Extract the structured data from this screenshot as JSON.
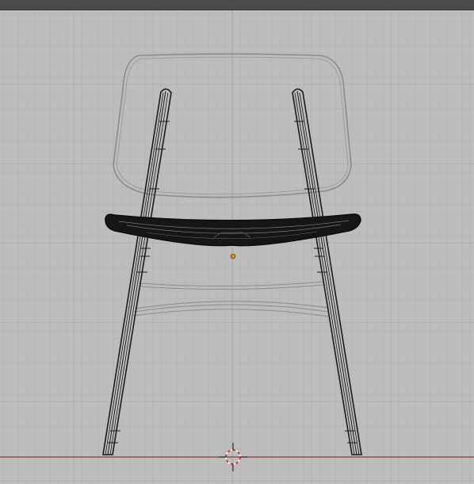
{
  "window": {
    "header_color": "#4a4a4a"
  },
  "viewport": {
    "view": "front-orthographic",
    "mode": "wireframe",
    "background_color": "#bdbdbd",
    "grid_minor_color": "#b3b3b3",
    "grid_major_color": "#a8a8a8",
    "ground_axis_color": "#8a3a3a",
    "wire_color": "#1c1c1c",
    "inactive_wire_color": "#8c8c8c"
  },
  "scene": {
    "object": {
      "name": "chair",
      "parts": [
        "backrest",
        "seat",
        "left-leg",
        "right-leg",
        "stretchers"
      ]
    },
    "origin_marker": {
      "icon": "object-origin-dot",
      "color": "#e08a20"
    },
    "cursor_3d": {
      "icon": "3d-cursor-icon",
      "color": "#d02020"
    }
  }
}
